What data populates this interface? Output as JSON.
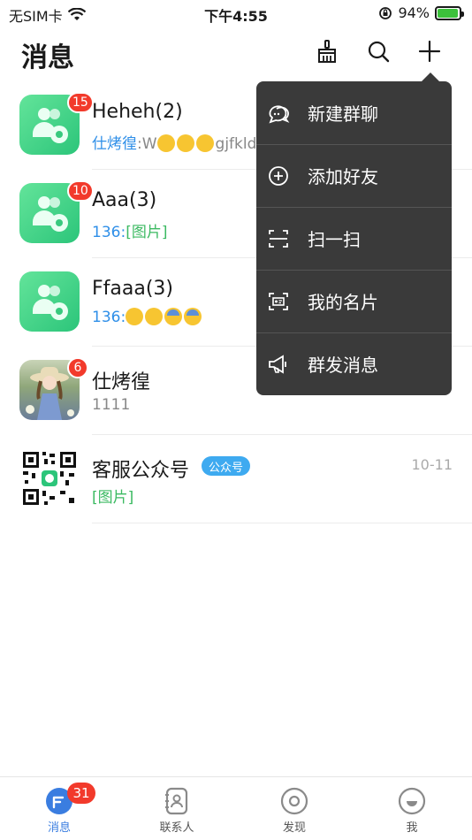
{
  "status_bar": {
    "carrier": "无SIM卡",
    "time": "下午4:55",
    "battery": "94%",
    "battery_level": 0.94
  },
  "header": {
    "title": "消息",
    "icons": [
      "broom-icon",
      "search-icon",
      "plus-icon"
    ]
  },
  "conversations": [
    {
      "name": "Heheh(2)",
      "badge": "15",
      "avatar": "group-avatar",
      "sender": "仕烤徨",
      "message": ":W",
      "trailing": "gjfkld",
      "emojis": [
        "laugh-cry",
        "tongue",
        "wink"
      ]
    },
    {
      "name": "Aaa(3)",
      "badge": "10",
      "avatar": "group-avatar",
      "sender": "136",
      "message": ":",
      "image_tag": "[图片]"
    },
    {
      "name": "Ffaaa(3)",
      "badge": "",
      "avatar": "group-avatar",
      "sender": "136",
      "message": ":",
      "emojis": [
        "heart-eyes",
        "heart-eyes",
        "anxious",
        "anxious"
      ]
    },
    {
      "name": "仕烤徨",
      "badge": "6",
      "avatar": "girl-photo-avatar",
      "preview": "1111"
    },
    {
      "name": "客服公众号",
      "tag": "公众号",
      "avatar": "qr-code-avatar",
      "image_tag": "[图片]",
      "time": "10-11"
    }
  ],
  "popup_menu": {
    "items": [
      {
        "label": "新建群聊",
        "icon": "group-chat-icon"
      },
      {
        "label": "添加好友",
        "icon": "add-friend-icon"
      },
      {
        "label": "扫一扫",
        "icon": "scan-icon"
      },
      {
        "label": "我的名片",
        "icon": "business-card-icon"
      },
      {
        "label": "群发消息",
        "icon": "megaphone-icon"
      }
    ]
  },
  "tab_bar": {
    "tabs": [
      {
        "label": "消息",
        "icon": "message-icon",
        "badge": "31",
        "active": true
      },
      {
        "label": "联系人",
        "icon": "contacts-icon"
      },
      {
        "label": "发现",
        "icon": "discover-icon"
      },
      {
        "label": "我",
        "icon": "me-icon"
      }
    ]
  },
  "colors": {
    "accent": "#3a7de0",
    "badge": "#f23a2b",
    "menu_bg": "#3a3a3a",
    "sender": "#2f8fe8",
    "image_tag": "#3cba62"
  }
}
